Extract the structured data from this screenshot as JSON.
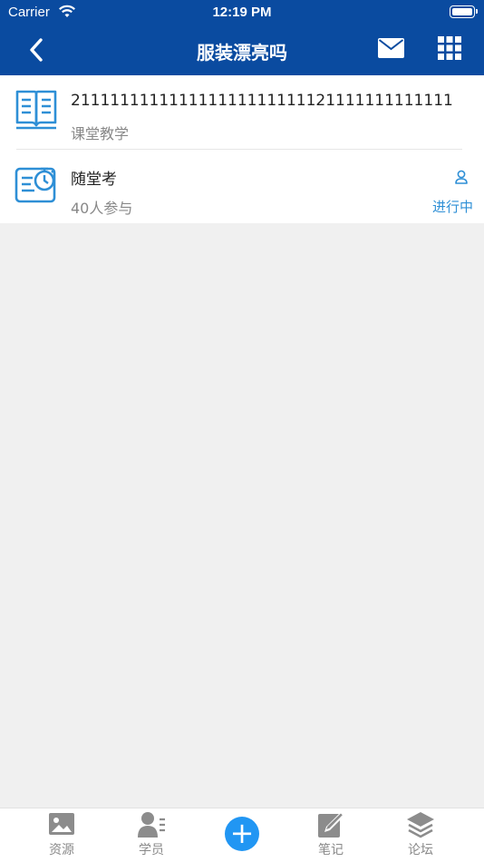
{
  "status_bar": {
    "carrier": "Carrier",
    "time": "12:19 PM"
  },
  "nav": {
    "title": "服装漂亮吗"
  },
  "items": [
    {
      "title": "211111111111111111111111121111111111111",
      "subtitle": "课堂教学",
      "icon": "book-icon"
    },
    {
      "title": "随堂考",
      "subtitle": "40人参与",
      "status": "进行中",
      "icon": "exam-timer-icon"
    }
  ],
  "tabbar": {
    "tabs": [
      {
        "label": "资源",
        "icon": "image-icon"
      },
      {
        "label": "学员",
        "icon": "students-icon"
      },
      {
        "label": "",
        "icon": "plus-icon"
      },
      {
        "label": "笔记",
        "icon": "note-edit-icon"
      },
      {
        "label": "论坛",
        "icon": "layers-icon"
      }
    ]
  },
  "colors": {
    "nav_bg": "#0a4ba0",
    "accent": "#2196f3",
    "page_bg": "#f0f0f0",
    "status_blue": "#2e8fd6"
  }
}
